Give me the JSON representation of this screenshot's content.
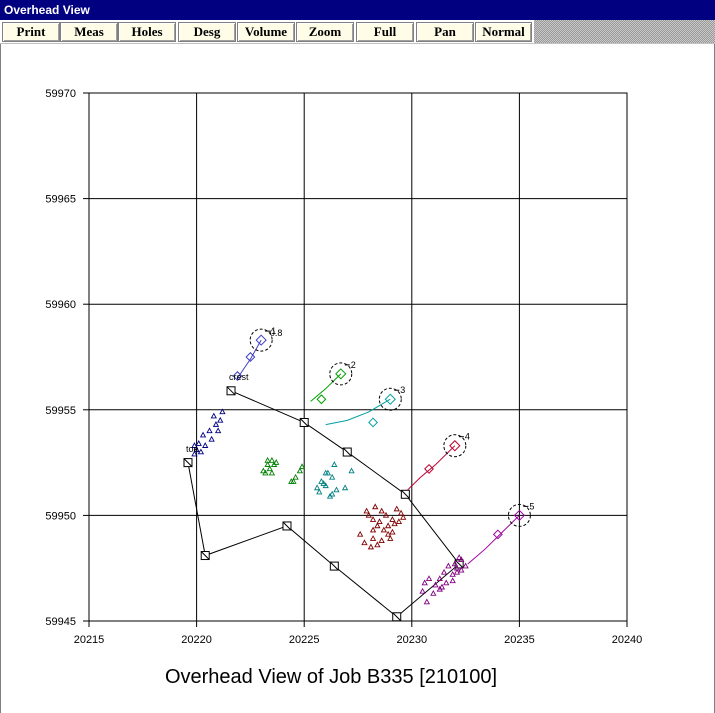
{
  "window": {
    "title": "Overhead View"
  },
  "toolbar": {
    "buttons": [
      {
        "id": "print",
        "label": "Print"
      },
      {
        "id": "meas",
        "label": "Meas"
      },
      {
        "id": "holes",
        "label": "Holes"
      },
      {
        "id": "desg",
        "label": "Desg"
      },
      {
        "id": "volume",
        "label": "Volume"
      },
      {
        "id": "zoom",
        "label": "Zoom"
      },
      {
        "id": "full",
        "label": "Full"
      },
      {
        "id": "pan",
        "label": "Pan"
      },
      {
        "id": "normal",
        "label": "Normal"
      }
    ]
  },
  "colors": {
    "titlebar": "#000080",
    "grid": "#000000",
    "blue_cluster": "#000080",
    "green_cluster": "#008000",
    "teal_cluster": "#008080",
    "red_cluster": "#800000",
    "magenta_cluster": "#800080",
    "hole1": "#4040c0",
    "hole2": "#00a000",
    "hole3": "#00a0a0",
    "hole4": "#c00030",
    "hole5": "#a000a0"
  },
  "chart_data": {
    "type": "scatter",
    "title": "Overhead View of Job B335 [210100]",
    "xlabel": "",
    "ylabel": "",
    "xlim": [
      20215,
      20240
    ],
    "ylim": [
      59945,
      59970
    ],
    "x_ticks": [
      20215,
      20220,
      20225,
      20230,
      20235,
      20240
    ],
    "y_ticks": [
      59945,
      59950,
      59955,
      59960,
      59965,
      59970
    ],
    "x_tick_labels": [
      "20215",
      "20220",
      "20225",
      "20230",
      "20235",
      "20240"
    ],
    "y_tick_labels": [
      "59945",
      "59950",
      "59955",
      "59960",
      "59965",
      "59970"
    ],
    "grid": true,
    "survey_line": {
      "points": [
        [
          20221.6,
          59955.9
        ],
        [
          20225.0,
          59954.4
        ],
        [
          20227.0,
          59953.0
        ],
        [
          20229.7,
          59951.0
        ],
        [
          20232.2,
          59947.7
        ],
        [
          20229.3,
          59945.2
        ],
        [
          20226.4,
          59947.6
        ],
        [
          20224.2,
          59949.5
        ],
        [
          20220.4,
          59948.1
        ],
        [
          20219.6,
          59952.5
        ]
      ],
      "squares": [
        [
          20225.0,
          59954.4
        ],
        [
          20227.0,
          59953.0
        ],
        [
          20229.7,
          59951.0
        ],
        [
          20232.2,
          59947.7
        ],
        [
          20229.3,
          59945.2
        ],
        [
          20226.4,
          59947.6
        ],
        [
          20224.2,
          59949.5
        ],
        [
          20220.4,
          59948.1
        ],
        [
          20219.6,
          59952.5
        ],
        [
          20221.6,
          59955.9
        ]
      ]
    },
    "labels": [
      {
        "text": "crest",
        "x": 20221.6,
        "y": 59956.4
      },
      {
        "text": "toe",
        "x": 20219.6,
        "y": 59953.0
      },
      {
        "text": "0.8",
        "x": 20223.5,
        "y": 59958.5
      }
    ],
    "holes": [
      {
        "name": "1",
        "center": [
          20223.0,
          59958.3
        ],
        "color_key": "hole1",
        "trace": [
          [
            20223.0,
            59958.3
          ],
          [
            20222.5,
            59957.4
          ],
          [
            20221.9,
            59956.5
          ]
        ]
      },
      {
        "name": "2",
        "center": [
          20226.7,
          59956.7
        ],
        "color_key": "hole2",
        "trace": [
          [
            20226.7,
            59956.7
          ],
          [
            20226.0,
            59956.0
          ],
          [
            20225.3,
            59955.4
          ]
        ]
      },
      {
        "name": "3",
        "center": [
          20229.0,
          59955.5
        ],
        "color_key": "hole3",
        "trace": [
          [
            20229.0,
            59955.5
          ],
          [
            20228.0,
            59954.9
          ],
          [
            20227.0,
            59954.5
          ],
          [
            20226.0,
            59954.3
          ]
        ]
      },
      {
        "name": "4",
        "center": [
          20232.0,
          59953.3
        ],
        "color_key": "hole4",
        "trace": [
          [
            20232.0,
            59953.3
          ],
          [
            20231.1,
            59952.4
          ],
          [
            20230.4,
            59951.8
          ],
          [
            20229.8,
            59951.2
          ]
        ]
      },
      {
        "name": "5",
        "center": [
          20235.0,
          59950.0
        ],
        "color_key": "hole5",
        "trace": [
          [
            20235.0,
            59950.0
          ],
          [
            20234.0,
            59949.0
          ],
          [
            20233.4,
            59948.4
          ],
          [
            20232.6,
            59947.7
          ]
        ]
      }
    ],
    "hole_side_markers": [
      {
        "hole": "1",
        "at": [
          20222.5,
          59957.5
        ]
      },
      {
        "hole": "1",
        "at": [
          20221.9,
          59956.6
        ]
      },
      {
        "hole": "2",
        "at": [
          20225.8,
          59955.5
        ]
      },
      {
        "hole": "3",
        "at": [
          20228.2,
          59954.4
        ]
      },
      {
        "hole": "4",
        "at": [
          20230.8,
          59952.2
        ]
      },
      {
        "hole": "5",
        "at": [
          20234.0,
          59949.1
        ]
      }
    ],
    "series": [
      {
        "color_key": "blue_cluster",
        "points": [
          [
            20219.9,
            59953.3
          ],
          [
            20220.1,
            59953.4
          ],
          [
            20220.0,
            59953.1
          ],
          [
            20220.2,
            59953.0
          ],
          [
            20220.4,
            59953.3
          ],
          [
            20220.6,
            59954.0
          ],
          [
            20220.3,
            59953.8
          ],
          [
            20220.9,
            59954.3
          ],
          [
            20220.8,
            59954.7
          ],
          [
            20221.1,
            59954.5
          ],
          [
            20221.2,
            59954.9
          ],
          [
            20220.7,
            59953.6
          ],
          [
            20221.0,
            59954.0
          ],
          [
            20219.9,
            59952.9
          ]
        ]
      },
      {
        "color_key": "green_cluster",
        "points": [
          [
            20223.1,
            59952.1
          ],
          [
            20223.3,
            59952.4
          ],
          [
            20223.5,
            59952.6
          ],
          [
            20223.4,
            59952.2
          ],
          [
            20223.6,
            59952.4
          ],
          [
            20223.2,
            59952.0
          ],
          [
            20223.5,
            59952.0
          ],
          [
            20223.7,
            59952.5
          ],
          [
            20223.3,
            59952.6
          ],
          [
            20224.4,
            59951.6
          ],
          [
            20224.6,
            59951.8
          ],
          [
            20224.8,
            59952.1
          ],
          [
            20224.9,
            59952.3
          ],
          [
            20224.5,
            59951.6
          ]
        ]
      },
      {
        "color_key": "teal_cluster",
        "points": [
          [
            20225.6,
            59951.3
          ],
          [
            20225.8,
            59951.6
          ],
          [
            20225.9,
            59951.5
          ],
          [
            20225.7,
            59951.1
          ],
          [
            20226.0,
            59951.4
          ],
          [
            20226.3,
            59951.8
          ],
          [
            20226.1,
            59952.0
          ],
          [
            20226.4,
            59952.4
          ],
          [
            20226.2,
            59950.9
          ],
          [
            20226.3,
            59951.0
          ],
          [
            20226.5,
            59951.2
          ],
          [
            20226.9,
            59951.3
          ],
          [
            20227.2,
            59952.1
          ],
          [
            20226.0,
            59952.0
          ]
        ]
      },
      {
        "color_key": "red_cluster",
        "points": [
          [
            20228.0,
            59950.0
          ],
          [
            20228.3,
            59950.4
          ],
          [
            20228.6,
            59950.2
          ],
          [
            20228.2,
            59949.8
          ],
          [
            20228.5,
            59949.7
          ],
          [
            20228.8,
            59950.0
          ],
          [
            20229.1,
            59949.8
          ],
          [
            20229.3,
            59950.3
          ],
          [
            20228.4,
            59949.5
          ],
          [
            20228.7,
            59949.3
          ],
          [
            20228.9,
            59949.5
          ],
          [
            20229.2,
            59949.6
          ],
          [
            20229.5,
            59950.1
          ],
          [
            20228.6,
            59948.8
          ],
          [
            20228.9,
            59949.1
          ],
          [
            20229.1,
            59949.2
          ],
          [
            20229.4,
            59949.7
          ],
          [
            20228.2,
            59948.9
          ],
          [
            20228.4,
            59948.6
          ],
          [
            20228.1,
            59948.5
          ],
          [
            20227.8,
            59948.7
          ],
          [
            20228.2,
            59949.3
          ],
          [
            20227.6,
            59949.1
          ],
          [
            20229.0,
            59948.9
          ],
          [
            20229.6,
            59949.9
          ],
          [
            20227.9,
            59950.2
          ]
        ]
      },
      {
        "color_key": "magenta_cluster",
        "points": [
          [
            20231.3,
            59947.0
          ],
          [
            20231.5,
            59947.3
          ],
          [
            20231.7,
            59947.6
          ],
          [
            20231.9,
            59947.2
          ],
          [
            20232.1,
            59947.5
          ],
          [
            20232.3,
            59947.9
          ],
          [
            20232.2,
            59948.0
          ],
          [
            20232.0,
            59947.7
          ],
          [
            20231.6,
            59946.8
          ],
          [
            20231.3,
            59946.5
          ],
          [
            20231.1,
            59946.7
          ],
          [
            20231.0,
            59946.3
          ],
          [
            20230.6,
            59946.8
          ],
          [
            20230.5,
            59946.4
          ],
          [
            20230.8,
            59947.0
          ],
          [
            20231.9,
            59946.9
          ],
          [
            20232.3,
            59947.4
          ],
          [
            20232.5,
            59947.6
          ],
          [
            20232.1,
            59947.3
          ],
          [
            20231.4,
            59946.6
          ],
          [
            20230.7,
            59945.9
          ]
        ]
      }
    ]
  }
}
